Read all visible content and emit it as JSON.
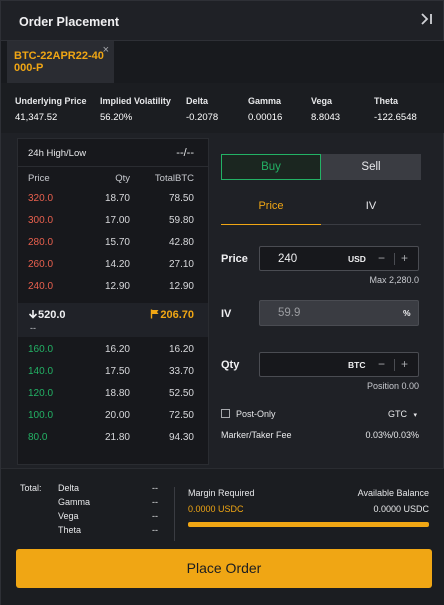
{
  "header": {
    "title": "Order Placement",
    "collapse_icon": "panel-collapse-icon"
  },
  "tab": {
    "label": "BTC-22APR22-40000-P",
    "close": "×"
  },
  "greeks": [
    {
      "key": "Underlying Price",
      "value": "41,347.52"
    },
    {
      "key": "Implied Volatility",
      "value": "56.20%"
    },
    {
      "key": "Delta",
      "value": "-0.2078"
    },
    {
      "key": "Gamma",
      "value": "0.00016"
    },
    {
      "key": "Vega",
      "value": "8.8043"
    },
    {
      "key": "Theta",
      "value": "-122.6548"
    }
  ],
  "book": {
    "high_low_label": "24h High/Low",
    "high_low_value": "--/--",
    "headers": [
      "Price",
      "Qty",
      "TotalBTC"
    ],
    "asks": [
      [
        "320.0",
        "18.70",
        "78.50"
      ],
      [
        "300.0",
        "17.00",
        "59.80"
      ],
      [
        "280.0",
        "15.70",
        "42.80"
      ],
      [
        "260.0",
        "14.20",
        "27.10"
      ],
      [
        "240.0",
        "12.90",
        "12.90"
      ]
    ],
    "last_price": "520.0",
    "last_sub": "--",
    "mark_price": "206.70",
    "bids": [
      [
        "160.0",
        "16.20",
        "16.20"
      ],
      [
        "140.0",
        "17.50",
        "33.70"
      ],
      [
        "120.0",
        "18.80",
        "52.50"
      ],
      [
        "100.0",
        "20.00",
        "72.50"
      ],
      [
        "80.0",
        "21.80",
        "94.30"
      ]
    ]
  },
  "form": {
    "buy": "Buy",
    "sell": "Sell",
    "tab_price": "Price",
    "tab_iv": "IV",
    "price_label": "Price",
    "price_value": "240",
    "price_unit": "USD",
    "price_max": "Max 2,280.0",
    "iv_label": "IV",
    "iv_value": "59.9",
    "iv_unit": "%",
    "qty_label": "Qty",
    "qty_value": "",
    "qty_unit": "BTC",
    "position": "Position 0.00",
    "post_only": "Post-Only",
    "tif": "GTC",
    "fee_label": "Marker/Taker Fee",
    "fee_value": "0.03%/0.03%"
  },
  "footer": {
    "total_label": "Total:",
    "totals": [
      {
        "key": "Delta",
        "value": "--"
      },
      {
        "key": "Gamma",
        "value": "--"
      },
      {
        "key": "Vega",
        "value": "--"
      },
      {
        "key": "Theta",
        "value": "--"
      }
    ],
    "margin_label": "Margin Required",
    "margin_value": "0.0000 USDC",
    "balance_label": "Available Balance",
    "balance_value": "0.0000 USDC",
    "place_order": "Place Order"
  },
  "colors": {
    "accent": "#f0a614",
    "bid": "#23b265",
    "ask": "#e8604e"
  }
}
